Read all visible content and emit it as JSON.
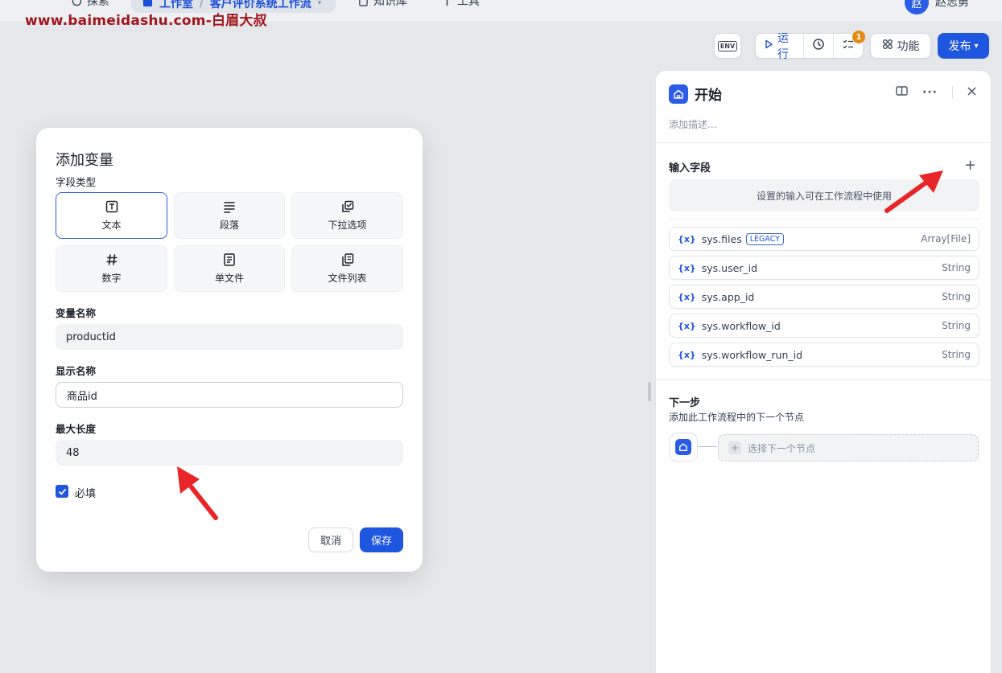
{
  "topnav": {
    "explore": "探索",
    "studio": "工作室",
    "workflow_name": "客户评价系统工作流",
    "knowledge": "知识库",
    "tools": "工具",
    "user_initial": "赵",
    "user_name": "赵志勇"
  },
  "watermark": "www.baimeidashu.com-白眉大叔",
  "toolbar": {
    "env_label": "ENV",
    "run_label": "运行",
    "checklist_badge": "1",
    "features_label": "功能",
    "publish_label": "发布"
  },
  "panel": {
    "title": "开始",
    "description_placeholder": "添加描述...",
    "input_fields_title": "输入字段",
    "input_hint": "设置的输入可在工作流程中使用",
    "variables": [
      {
        "name": "sys.files",
        "tag": "LEGACY",
        "type": "Array[File]"
      },
      {
        "name": "sys.user_id",
        "tag": "",
        "type": "String"
      },
      {
        "name": "sys.app_id",
        "tag": "",
        "type": "String"
      },
      {
        "name": "sys.workflow_id",
        "tag": "",
        "type": "String"
      },
      {
        "name": "sys.workflow_run_id",
        "tag": "",
        "type": "String"
      }
    ],
    "var_brace": "{x}",
    "next_step_title": "下一步",
    "next_step_desc": "添加此工作流程中的下一个节点",
    "select_next_node": "选择下一个节点"
  },
  "modal": {
    "title": "添加变量",
    "field_type_label": "字段类型",
    "types": [
      {
        "label": "文本",
        "icon": "text-icon",
        "selected": true
      },
      {
        "label": "段落",
        "icon": "paragraph-icon",
        "selected": false
      },
      {
        "label": "下拉选项",
        "icon": "select-icon",
        "selected": false
      },
      {
        "label": "数字",
        "icon": "number-icon",
        "selected": false
      },
      {
        "label": "单文件",
        "icon": "file-icon",
        "selected": false
      },
      {
        "label": "文件列表",
        "icon": "file-list-icon",
        "selected": false
      }
    ],
    "var_name_label": "变量名称",
    "var_name_value": "productid",
    "display_name_label": "显示名称",
    "display_name_value": "商品id",
    "max_length_label": "最大长度",
    "max_length_value": "48",
    "required_label": "必填",
    "required_checked": true,
    "cancel_label": "取消",
    "save_label": "保存"
  },
  "colors": {
    "primary": "#1f56e0",
    "badge": "#e38b12",
    "watermark": "#a1151c",
    "annotation_arrow": "#e8262a"
  }
}
